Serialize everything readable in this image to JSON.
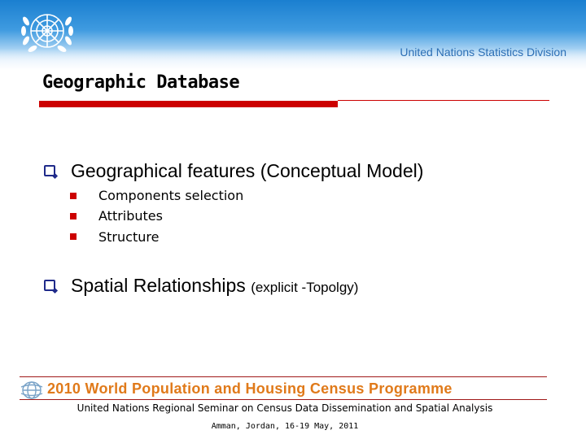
{
  "header": {
    "organization": "United Nations Statistics Division",
    "logo_icon": "un-emblem-icon",
    "gradient_top": "#1a7fd0",
    "gradient_bottom": "#eef6fd"
  },
  "slide": {
    "title": "Geographic Database",
    "accent_color": "#cc0000",
    "bullets": [
      {
        "text": "Geographical features (Conceptual Model)",
        "subitems": [
          "Components selection",
          "Attributes",
          "Structure"
        ]
      },
      {
        "text": "Spatial Relationships",
        "suffix": "(explicit -Topolgy)"
      }
    ]
  },
  "footer": {
    "programme": "2010 World Population and Housing Census Programme",
    "programme_color": "#e07a1a",
    "seminar": "United Nations Regional Seminar on Census Data Dissemination and Spatial Analysis",
    "venue": "Amman, Jordan, 16-19 May, 2011"
  }
}
